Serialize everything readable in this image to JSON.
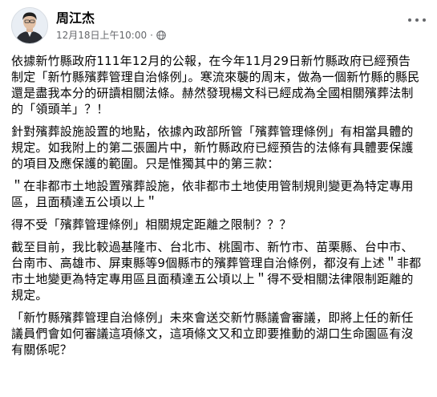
{
  "post": {
    "author": "周江杰",
    "date": "12月18日上午10:00",
    "separator": "·",
    "privacy_icon": "globe-icon",
    "more_icon": "more-options-icon",
    "paragraphs": [
      "依據新竹縣政府111年12月的公報，在今年11月29日新竹縣政府已經預告制定「新竹縣殯葬管理自治條例」。寒流來襲的周末，做為一個新竹縣的縣民還是盡我本分的研讀相關法條。赫然發現楊文科已經成為全國相關殯葬法制的「領頭羊」？！",
      "針對殯葬設施設置的地點，依據內政部所管「殯葬管理條例」有相當具體的規定。如我附上的第二張圖片中，新竹縣政府已經預告的法條有具體要保護的項目及應保護的範圍。只是惟獨其中的第三款：",
      "＂在非都市土地設置殯葬設施，依非都市土地使用管制規則變更為特定專用區，且面積達五公頃以上＂",
      "得不受「殯葬管理條例」相關規定距離之限制？？？",
      "截至目前，我比較過基隆市、台北市、桃園市、新竹市、苗栗縣、台中市、台南市、高雄市、屏東縣等9個縣市的殯葬管理自治條例，都沒有上述＂非都市土地變更為特定專用區且面積達五公頃以上＂得不受相關法律限制距離的規定。",
      "「新竹縣殯葬管理自治條例」未來會送交新竹縣議會審議，即將上任的新任議員們會如何審議這項條文，這項條文又和立即要推動的湖口生命園區有沒有關係呢？"
    ]
  }
}
